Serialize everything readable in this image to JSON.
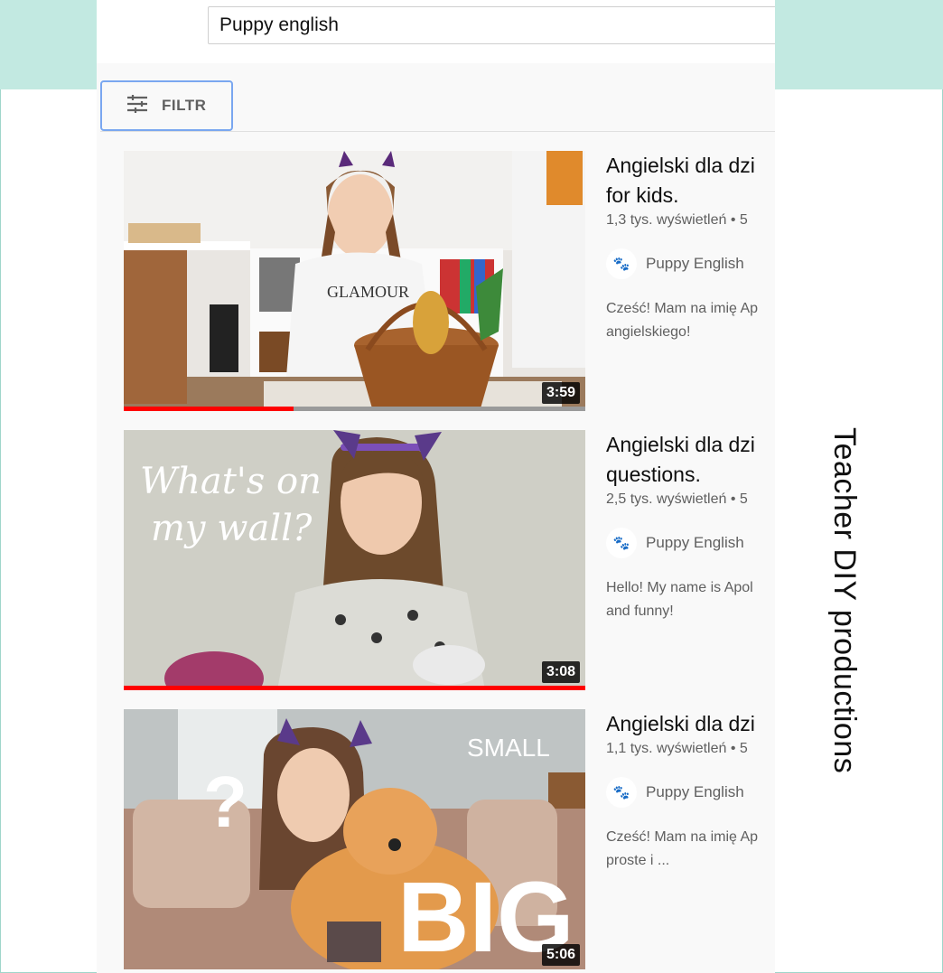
{
  "search": {
    "query": "Puppy english"
  },
  "filter": {
    "label": "FILTR"
  },
  "videos": [
    {
      "title_lines": [
        "Angielski dla dzi",
        "for kids."
      ],
      "views": "1,3 tys. wyświetleń • 5",
      "channel": "Puppy English",
      "desc_lines": [
        "Cześć! Mam na imię Ap",
        "angielskiego!"
      ],
      "duration": "3:59",
      "watched_fraction": 0.37
    },
    {
      "title_lines": [
        "Angielski dla dzi",
        "questions."
      ],
      "views": "2,5 tys. wyświetleń • 5",
      "channel": "Puppy English",
      "desc_lines": [
        "Hello! My name is Apol",
        "and funny!"
      ],
      "duration": "3:08",
      "thumb_text": [
        "What's on",
        "my wall?"
      ],
      "watched_fraction": 1.0
    },
    {
      "title_lines": [
        "Angielski dla dzi"
      ],
      "views": "1,1 tys. wyświetleń • 5",
      "channel": "Puppy English",
      "desc_lines": [
        "Cześć! Mam na imię Ap",
        "proste i ..."
      ],
      "duration": "5:06",
      "thumb_text": [
        "?",
        "SMALL",
        "BIG"
      ]
    }
  ],
  "side_caption": "Teacher DIY productions",
  "colors": {
    "accent_frame": "#c2e9e1",
    "progress": "#ff0000",
    "filter_outline": "#7aa7f0"
  }
}
